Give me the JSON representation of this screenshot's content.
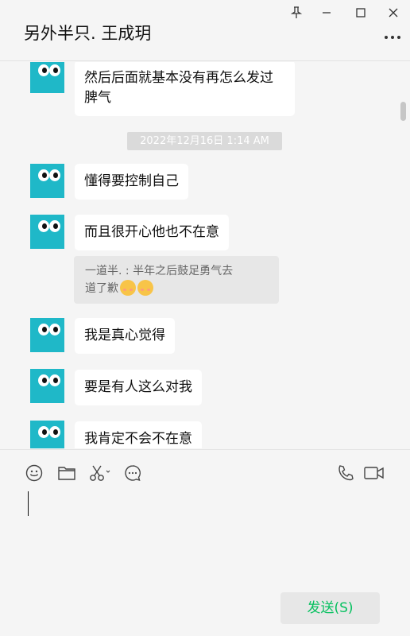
{
  "header": {
    "title": "另外半只. 王成玥",
    "pin_icon": "pin-icon",
    "minimize_icon": "minimize-icon",
    "maximize_icon": "maximize-icon",
    "close_icon": "close-icon",
    "more_icon": "more-icon"
  },
  "messages": [
    {
      "lines": [
        "然后后面就基本没有再怎么发过",
        "脾气"
      ]
    },
    {
      "timestamp": "2022年12月16日 1:14 AM"
    },
    {
      "text": "懂得要控制自己"
    },
    {
      "text": "而且很开心他也不在意"
    },
    {
      "quote_line1": "一道半. : 半年之后鼓足勇气去",
      "quote_line2": "道了歉"
    },
    {
      "text": "我是真心觉得"
    },
    {
      "text": "要是有人这么对我"
    },
    {
      "text": "我肯定不会不在意"
    }
  ],
  "toolbar": {
    "icons": [
      "emoji-icon",
      "folder-icon",
      "scissors-icon",
      "chat-bubble-icon",
      "phone-icon",
      "video-icon"
    ],
    "send_label": "发送(S)"
  },
  "colors": {
    "avatar_bg": "#1fb8c8",
    "send_text": "#07c160",
    "background": "#f5f5f5"
  }
}
